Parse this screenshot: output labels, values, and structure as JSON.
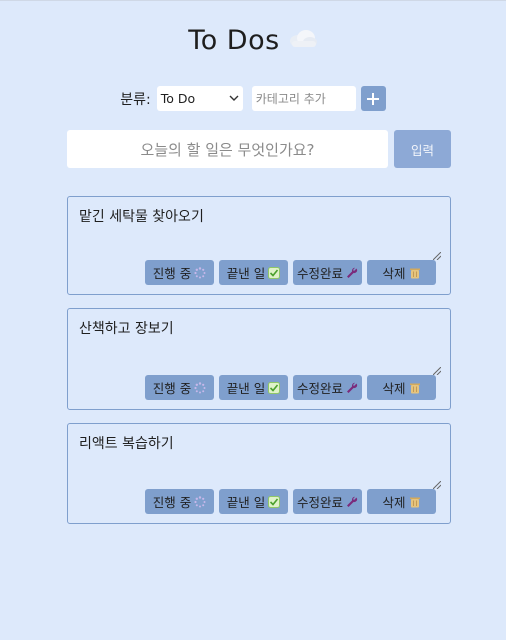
{
  "header": {
    "title": "To Dos",
    "icon": "cloud-icon"
  },
  "category": {
    "label": "분류:",
    "selected": "To Do",
    "add_placeholder": "카테고리 추가",
    "add_icon": "plus-icon"
  },
  "todo_form": {
    "placeholder": "오늘의 할 일은 무엇인가요?",
    "submit_label": "입력"
  },
  "todos": [
    {
      "text": "맡긴 세탁물 찾아오기"
    },
    {
      "text": "산책하고 장보기"
    },
    {
      "text": "리액트 복습하기"
    }
  ],
  "actions": {
    "doing_label": "진행 중",
    "done_label": "끝낸 일",
    "edit_label": "수정완료",
    "delete_label": "삭제"
  },
  "colors": {
    "background": "#dde9fb",
    "button": "#7f9fcd",
    "submit": "#8da9d6",
    "card_border": "#7f9fcd"
  }
}
